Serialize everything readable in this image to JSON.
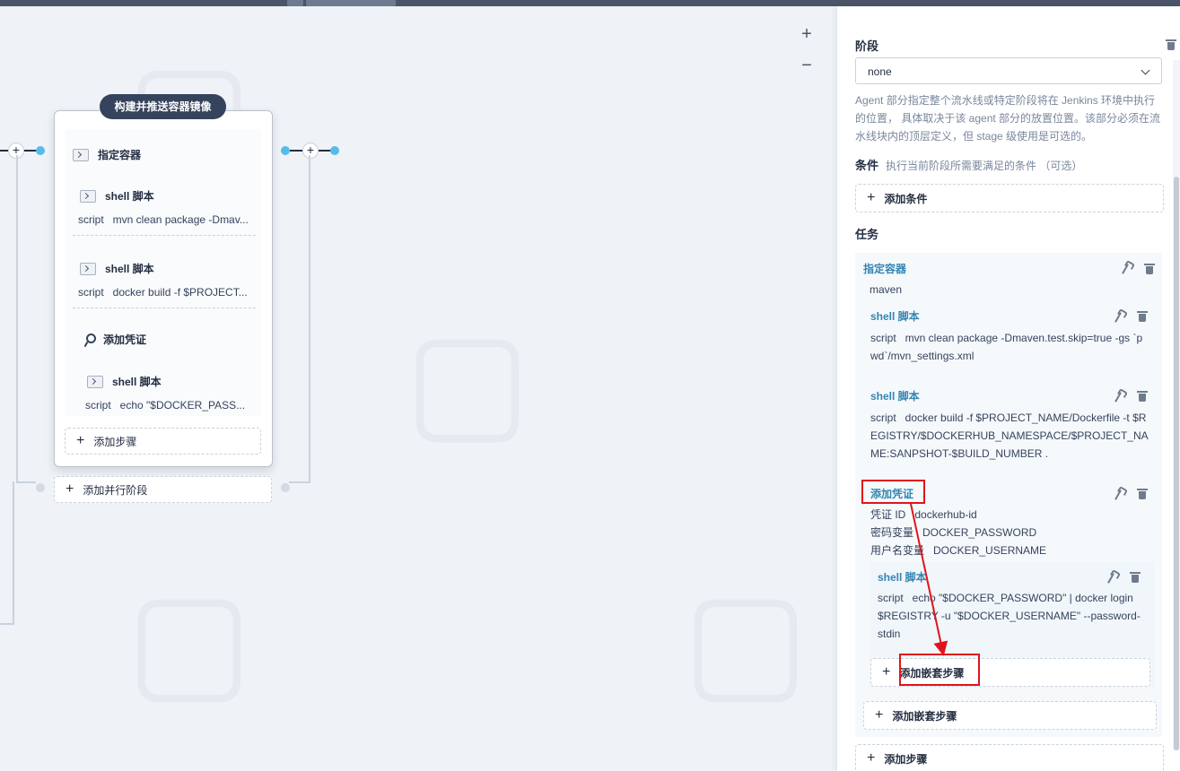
{
  "canvas": {
    "zoom_in": "+",
    "zoom_out": "−",
    "stage": {
      "title": "构建并推送容器镜像",
      "container_step": "指定容器",
      "steps": [
        {
          "name": "shell 脚本",
          "key": "script",
          "value": "mvn clean package -Dmav..."
        },
        {
          "name": "shell 脚本",
          "key": "script",
          "value": "docker build -f $PROJECT..."
        }
      ],
      "credential_step": "添加凭证",
      "nested_step": {
        "name": "shell 脚本",
        "key": "script",
        "value": "echo \"$DOCKER_PASS..."
      },
      "add_step": "添加步骤"
    },
    "add_parallel_stage": "添加并行阶段"
  },
  "panel": {
    "stage_label": "阶段",
    "agent_select": "none",
    "agent_desc": "Agent 部分指定整个流水线或特定阶段将在 Jenkins 环境中执行的位置， 具体取决于该 agent 部分的放置位置。该部分必须在流水线块内的顶层定义，但 stage 级使用是可选的。",
    "condition_label": "条件",
    "condition_desc": "执行当前阶段所需要满足的条件 （可选）",
    "add_condition": "添加条件",
    "tasks_label": "任务",
    "container": {
      "name": "指定容器",
      "value": "maven"
    },
    "shell1": {
      "name": "shell 脚本",
      "key": "script",
      "value": "mvn clean package -Dmaven.test.skip=true -gs `p",
      "value2": "wd`/mvn_settings.xml"
    },
    "shell2": {
      "name": "shell 脚本",
      "key": "script",
      "value": "docker build -f $PROJECT_NAME/Dockerfile -t $R",
      "value2": "EGISTRY/$DOCKERHUB_NAMESPACE/$PROJECT_NA",
      "value3": "ME:SANPSHOT-$BUILD_NUMBER ."
    },
    "credential": {
      "name": "添加凭证",
      "id_label": "凭证 ID",
      "id_value": "dockerhub-id",
      "pwd_label": "密码变量",
      "pwd_value": "DOCKER_PASSWORD",
      "user_label": "用户名变量",
      "user_value": "DOCKER_USERNAME"
    },
    "shell3": {
      "name": "shell 脚本",
      "key": "script",
      "value": "echo \"$DOCKER_PASSWORD\" | docker login",
      "value2": "$REGISTRY -u \"$DOCKER_USERNAME\" --password-",
      "value3": "stdin"
    },
    "add_nested_inner": "添加嵌套步骤",
    "add_nested_outer": "添加嵌套步骤",
    "add_step": "添加步骤"
  },
  "colors": {
    "accent": "#3385b2",
    "highlight": "#e0141c",
    "stage_title_bg": "#36435c",
    "connector": "#55bbeb"
  }
}
